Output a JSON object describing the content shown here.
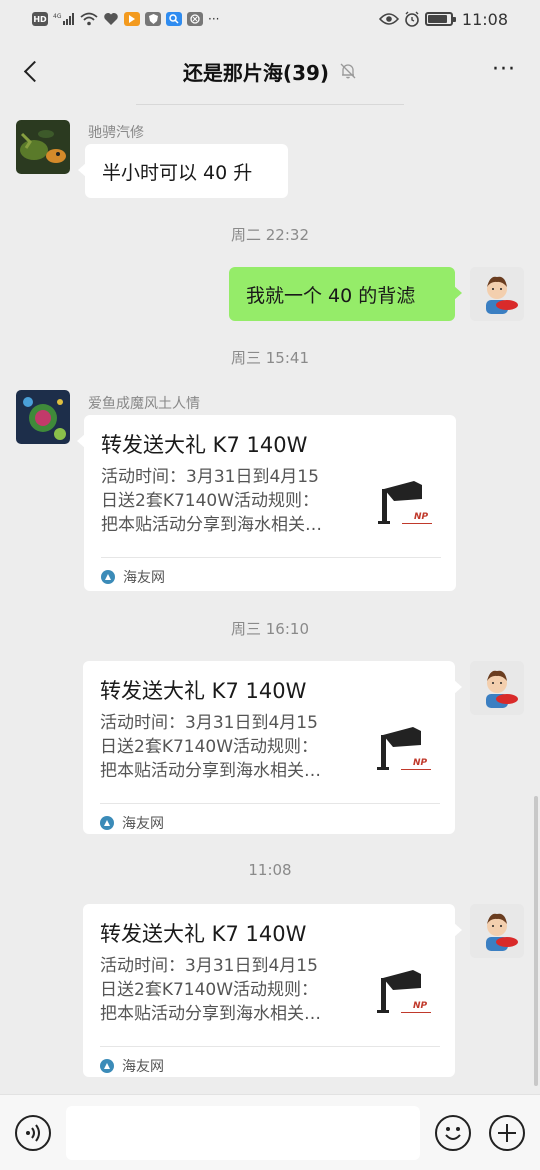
{
  "status_bar": {
    "left_icons": [
      "hd-icon",
      "4g-signal-icon",
      "wifi-icon",
      "heart-app-icon",
      "video-app-icon",
      "shield-app-icon",
      "search-app-icon",
      "browser-app-icon",
      "more-notifications-icon"
    ],
    "signal_label": "4G",
    "hd_label": "HD",
    "more_label": "···",
    "time": "11:08"
  },
  "header": {
    "title": "还是那片海(39)",
    "more_label": "···"
  },
  "messages": {
    "m1": {
      "sender": "驰骋汽修",
      "text": "半小时可以 40 升"
    },
    "t1": "周二 22:32",
    "m2": {
      "text": "我就一个 40 的背滤"
    },
    "t2": "周三 15:41",
    "m3": {
      "sender": "爱鱼成魔风土人情",
      "title": "转发送大礼 K7 140W",
      "desc_lines": [
        "活动时间：3月31日到4月15",
        "日送2套K7140W活动规则：",
        "把本贴活动分享到海水相关…"
      ],
      "source": "海友网"
    },
    "t3": "周三 16:10",
    "m4": {
      "title": "转发送大礼 K7 140W",
      "desc_lines": [
        "活动时间：3月31日到4月15",
        "日送2套K7140W活动规则：",
        "把本贴活动分享到海水相关…"
      ],
      "source": "海友网"
    },
    "t4": "11:08",
    "m5": {
      "title": "转发送大礼 K7 140W",
      "desc_lines": [
        "活动时间：3月31日到4月15",
        "日送2套K7140W活动规则：",
        "把本贴活动分享到海水相关…"
      ],
      "source": "海友网"
    }
  },
  "input_bar": {
    "placeholder": "",
    "value": ""
  },
  "colors": {
    "background": "#ededed",
    "sent_bubble": "#95ec69",
    "received_bubble": "#ffffff",
    "timestamp": "#8a8a8a"
  }
}
